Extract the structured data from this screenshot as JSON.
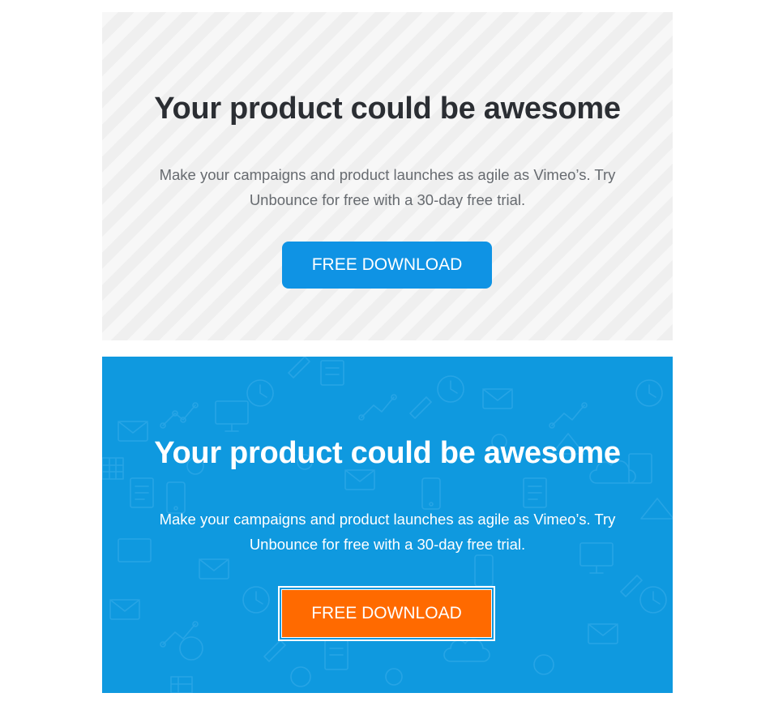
{
  "light_section": {
    "heading": "Your product could be awesome",
    "description": "Make your campaigns and product launches as agile as Vimeo’s. Try Unbounce for free with a 30-day free trial.",
    "button_label": "FREE DOWNLOAD"
  },
  "blue_section": {
    "heading": "Your product could be awesome",
    "description": "Make your campaigns and product launches as agile as Vimeo’s. Try Unbounce for free with a 30-day free trial.",
    "button_label": "FREE DOWNLOAD"
  },
  "colors": {
    "light_background": "#f7f7f7",
    "blue_background": "#0f99df",
    "primary_button": "#0f93e4",
    "orange_button": "#ff6a00",
    "heading_dark": "#2b2e33",
    "text_gray": "#676b70"
  }
}
